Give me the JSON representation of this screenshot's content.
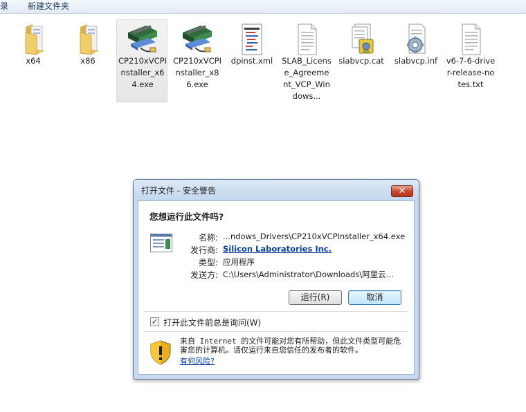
{
  "toolbar": {
    "left_fragment": "录",
    "new_folder": "新建文件夹"
  },
  "files": [
    {
      "label": "x64",
      "icon": "folder-icon"
    },
    {
      "label": "x86",
      "icon": "folder-icon"
    },
    {
      "label": "CP210xVCPInstaller_x64.exe",
      "icon": "installer-exe-icon",
      "selected": true
    },
    {
      "label": "CP210xVCPInstaller_x86.exe",
      "icon": "installer-exe-icon"
    },
    {
      "label": "dpinst.xml",
      "icon": "xml-file-icon"
    },
    {
      "label": "SLAB_License_Agreement_VCP_Windows...",
      "icon": "text-file-icon"
    },
    {
      "label": "slabvcp.cat",
      "icon": "security-catalog-icon"
    },
    {
      "label": "slabvcp.inf",
      "icon": "setup-info-icon"
    },
    {
      "label": "v6-7-6-driver-release-notes.txt",
      "icon": "text-file-icon"
    }
  ],
  "dialog": {
    "title": "打开文件 - 安全警告",
    "close_symbol": "✕",
    "question": "您想运行此文件吗?",
    "name_label": "名称:",
    "name_value": "...ndows_Drivers\\CP210xVCPInstaller_x64.exe",
    "publisher_label": "发行商:",
    "publisher_value": "Silicon Laboratories Inc.",
    "type_label": "类型:",
    "type_value": "应用程序",
    "from_label": "发送方:",
    "from_value": "C:\\Users\\Administrator\\Downloads\\阿里云...",
    "run_button": "运行(R)",
    "cancel_button": "取消",
    "checkbox_label": "打开此文件前总是询问(W)",
    "checkbox_checked": true,
    "checkbox_mark": "✓",
    "warning_text": "来自 Internet 的文件可能对您有所帮助，但此文件类型可能危害您的计算机。请仅运行来自您信任的发布者的软件。",
    "risk_link": "有何风险?"
  },
  "colors": {
    "link": "#0b3fa8",
    "dialog_frame": "#c6d9ef",
    "close_button": "#c7442a"
  }
}
